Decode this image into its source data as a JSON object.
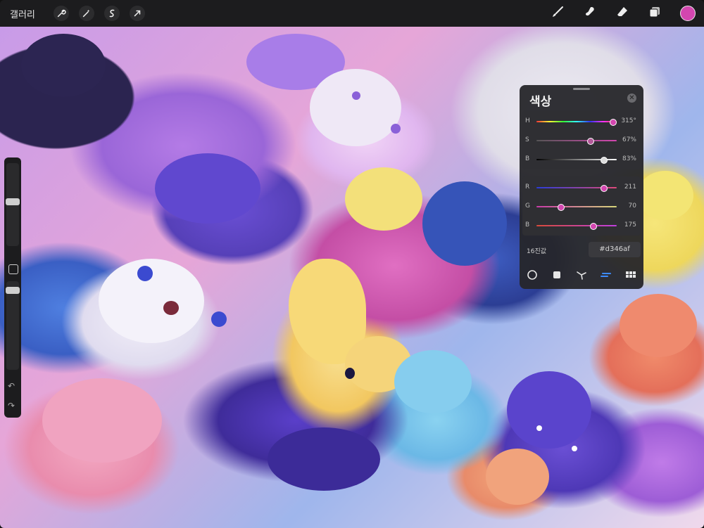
{
  "toolbar": {
    "gallery_label": "갤러리",
    "left_tools": [
      "wrench-icon",
      "magic-wand-icon",
      "selection-icon",
      "transform-arrow-icon"
    ],
    "right_tools": [
      "brush-icon",
      "smudge-icon",
      "eraser-icon",
      "layers-icon"
    ],
    "current_color": "#d346af"
  },
  "color_panel": {
    "title": "색상",
    "hsb": [
      {
        "label": "H",
        "value": "315°",
        "fraction": 0.87
      },
      {
        "label": "S",
        "value": "67%",
        "fraction": 0.67
      },
      {
        "label": "B",
        "value": "83%",
        "fraction": 0.83
      }
    ],
    "rgb": [
      {
        "label": "R",
        "value": "211",
        "fraction": 0.83
      },
      {
        "label": "G",
        "value": "70",
        "fraction": 0.27
      },
      {
        "label": "B",
        "value": "175",
        "fraction": 0.69
      }
    ],
    "hex_label": "16진값",
    "hex_value": "#d346af",
    "modes": [
      "disc-mode-icon",
      "classic-mode-icon",
      "harmony-mode-icon",
      "value-mode-icon",
      "palette-mode-icon"
    ],
    "active_mode": "value-mode-icon"
  },
  "sidebar": {
    "brush_size_fraction": 0.5,
    "opacity_fraction": 0.9
  }
}
